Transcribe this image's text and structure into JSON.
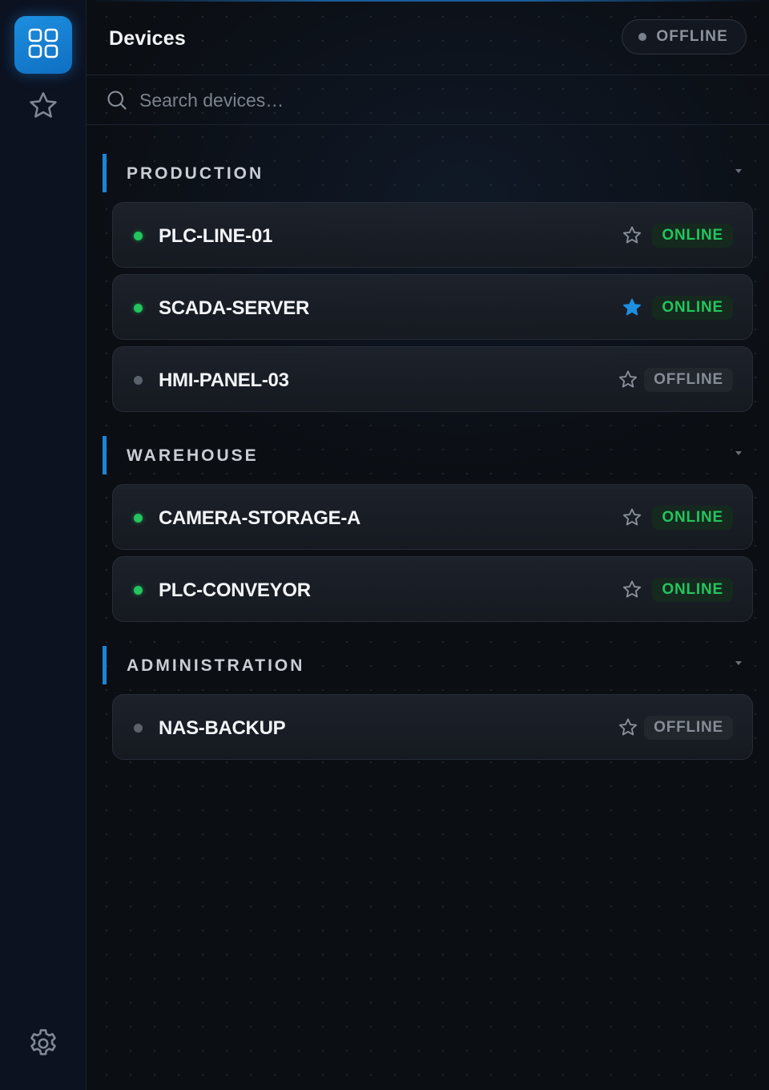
{
  "sidebar": {
    "items": [
      {
        "name": "devices",
        "icon": "grid-icon",
        "active": true
      },
      {
        "name": "favorites",
        "icon": "star-icon",
        "active": false
      },
      {
        "name": "settings",
        "icon": "gear-icon",
        "active": false
      }
    ]
  },
  "header": {
    "title": "Devices",
    "connection_status": "OFFLINE"
  },
  "search": {
    "placeholder": "Search devices…",
    "value": ""
  },
  "colors": {
    "accent": "#1a86d9",
    "online": "#22c55e",
    "offline": "#868d97",
    "favorite_star": "#1d8fe0"
  },
  "groups": [
    {
      "title": "PRODUCTION",
      "devices": [
        {
          "name": "PLC-LINE-01",
          "status": "ONLINE",
          "favorite": false
        },
        {
          "name": "SCADA-SERVER",
          "status": "ONLINE",
          "favorite": true
        },
        {
          "name": "HMI-PANEL-03",
          "status": "OFFLINE",
          "favorite": false
        }
      ]
    },
    {
      "title": "WAREHOUSE",
      "devices": [
        {
          "name": "CAMERA-STORAGE-A",
          "status": "ONLINE",
          "favorite": false
        },
        {
          "name": "PLC-CONVEYOR",
          "status": "ONLINE",
          "favorite": false
        }
      ]
    },
    {
      "title": "ADMINISTRATION",
      "devices": [
        {
          "name": "NAS-BACKUP",
          "status": "OFFLINE",
          "favorite": false
        }
      ]
    }
  ]
}
